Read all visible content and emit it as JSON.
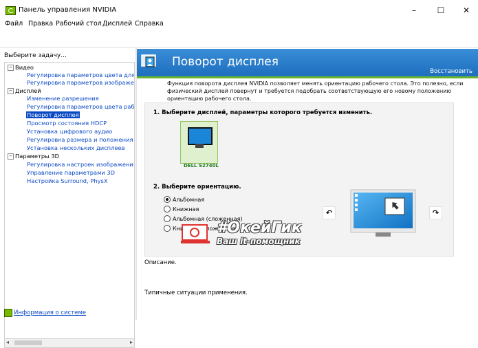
{
  "window": {
    "title": "Панель управления NVIDIA",
    "controls": [
      "–",
      "☐",
      "✕"
    ]
  },
  "menu": [
    {
      "label": "Файл"
    },
    {
      "label": "Правка"
    },
    {
      "label": "Рабочий стол"
    },
    {
      "label": "Дисплей"
    },
    {
      "label": "Справка"
    }
  ],
  "sidebar": {
    "title": "Выберите задачу...",
    "categories": [
      {
        "label": "Видео",
        "items": [
          "Регулировка параметров цвета для вид",
          "Регулировка параметров изображения д"
        ]
      },
      {
        "label": "Дисплей",
        "items": [
          "Изменение разрешения",
          "Регулировка параметров цвета рабочег",
          "Поворот дисплея",
          "Просмотр состояния HDCP",
          "Установка цифрового аудио",
          "Регулировка размера и положения рабо",
          "Установка нескольких дисплеев"
        ]
      },
      {
        "label": "Параметры 3D",
        "items": [
          "Регулировка настроек изображения с пр",
          "Управление параметрами 3D",
          "Настройка Surround, PhysX"
        ]
      }
    ],
    "selected": "Поворот дисплея",
    "system_info": "Информация о системе"
  },
  "content": {
    "title": "Поворот дисплея",
    "restore": "Восстановить",
    "description": "Функция поворота дисплея NVIDIA позволяет менять ориентацию рабочего стола. Это полезно, если физический дисплей повернут и требуется подобрать соответствующую его новому положению ориентацию рабочего стола.",
    "step1": "1. Выберите дисплей, параметры которого требуется изменить.",
    "display_name": "DELL S2740L",
    "step2": "2. Выберите ориентацию.",
    "orientations": [
      {
        "label": "Альбомная",
        "selected": true
      },
      {
        "label": "Книжная",
        "selected": false
      },
      {
        "label": "Альбомная (сложенная)",
        "selected": false
      },
      {
        "label": "Книжная (сложенная)",
        "selected": false
      }
    ],
    "description_label": "Описание.",
    "usage_label": "Типичные ситуации применения."
  },
  "watermark": {
    "title": "#ОкейГик",
    "subtitle": "Ваш it-помощник"
  },
  "colors": {
    "header": "#1d6fbf",
    "accent_green": "#76b900",
    "link": "#0a49c4"
  }
}
